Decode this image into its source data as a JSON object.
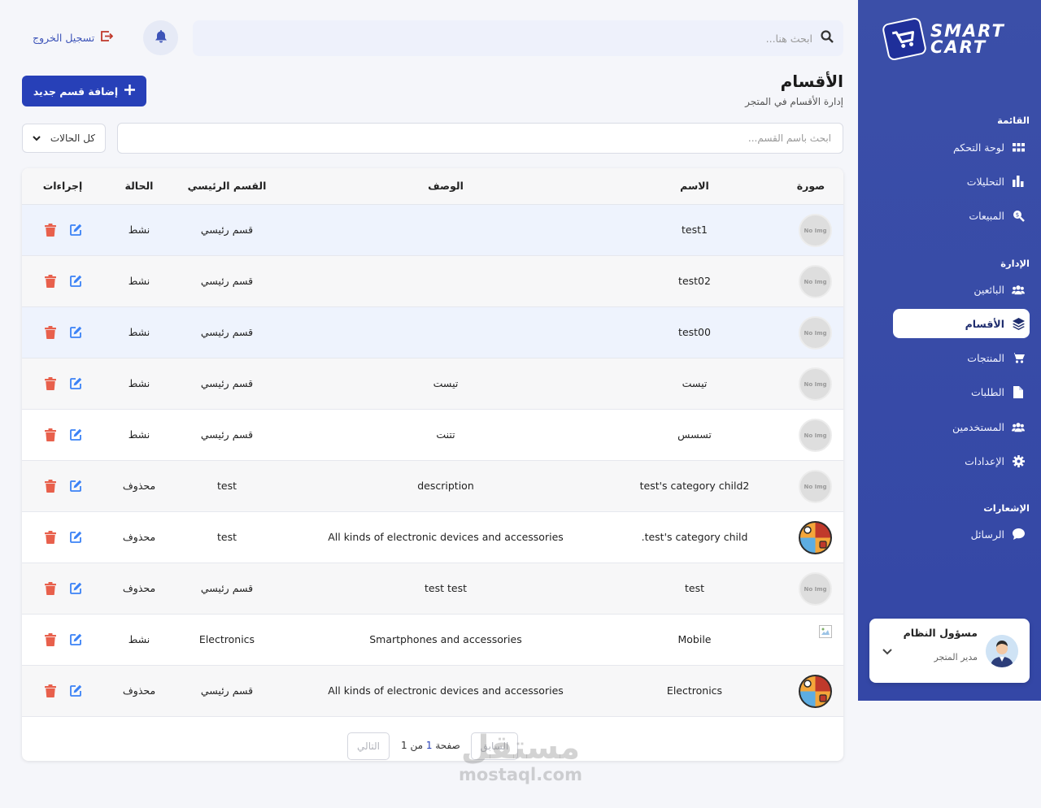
{
  "brand": {
    "line1": "SMART",
    "line2": "CART"
  },
  "sidebar": {
    "sections": [
      {
        "label": "القائمة"
      },
      {
        "label": "الإدارة"
      },
      {
        "label": "الإشعارات"
      }
    ],
    "items": [
      {
        "label": "لوحة التحكم",
        "icon": "grid-icon"
      },
      {
        "label": "التحليلات",
        "icon": "bar-chart-icon"
      },
      {
        "label": "المبيعات",
        "icon": "search-dollar-icon"
      },
      {
        "label": "البائعين",
        "icon": "users-icon"
      },
      {
        "label": "الأقسام",
        "icon": "layers-icon",
        "active": true
      },
      {
        "label": "المنتجات",
        "icon": "cart-icon"
      },
      {
        "label": "الطلبات",
        "icon": "file-icon"
      },
      {
        "label": "المستخدمين",
        "icon": "users-icon"
      },
      {
        "label": "الإعدادات",
        "icon": "gear-icon"
      },
      {
        "label": "الرسائل",
        "icon": "chat-icon"
      }
    ],
    "user": {
      "name": "مسؤول النظام",
      "role": "مدير المتجر"
    }
  },
  "topbar": {
    "search_placeholder": "ابحث هنا...",
    "logout_label": "تسجيل الخروج"
  },
  "page": {
    "title": "الأقسام",
    "subtitle": "إدارة الأقسام في المتجر",
    "add_button": "إضافة قسم جديد"
  },
  "filters": {
    "search_placeholder": "ابحث باسم القسم...",
    "status_selected": "كل الحالات"
  },
  "table": {
    "headers": {
      "image": "صورة",
      "name": "الاسم",
      "description": "الوصف",
      "parent": "القسم الرئيسي",
      "status": "الحالة",
      "actions": "إجراءات"
    },
    "rows": [
      {
        "image": "none",
        "name": "test1",
        "description": "",
        "parent": "قسم رئيسي",
        "status": "نشط"
      },
      {
        "image": "none",
        "name": "test02",
        "description": "",
        "parent": "قسم رئيسي",
        "status": "نشط"
      },
      {
        "image": "none",
        "name": "test00",
        "description": "",
        "parent": "قسم رئيسي",
        "status": "نشط"
      },
      {
        "image": "none",
        "name": "تيست",
        "description": "تيست",
        "parent": "قسم رئيسي",
        "status": "نشط"
      },
      {
        "image": "none",
        "name": "تسسس",
        "description": "تتنت",
        "parent": "قسم رئيسي",
        "status": "نشط"
      },
      {
        "image": "none",
        "name": "test's category child2",
        "description": "description",
        "parent": "test",
        "status": "محذوف"
      },
      {
        "image": "icon",
        "name": "test's category child.",
        "description": "All kinds of electronic devices and accessories",
        "parent": "test",
        "status": "محذوف"
      },
      {
        "image": "none",
        "name": "test",
        "description": "test test",
        "parent": "قسم رئيسي",
        "status": "محذوف"
      },
      {
        "image": "broken",
        "name": "Mobile",
        "description": "Smartphones and accessories",
        "parent": "Electronics",
        "status": "نشط"
      },
      {
        "image": "icon",
        "name": "Electronics",
        "description": "All kinds of electronic devices and accessories",
        "parent": "قسم رئيسي",
        "status": "محذوف"
      }
    ],
    "no_img_label": "No Img"
  },
  "pagination": {
    "prev": "السابق",
    "next": "التالي",
    "label_page": "صفحة",
    "current": "1",
    "label_of": "من",
    "total": "1"
  },
  "watermark": {
    "ar": "مستقل",
    "en": "mostaql.com"
  },
  "colors": {
    "sidebar": "#3b4fa8",
    "primary": "#2740b8",
    "delete": "#e8604c",
    "edit": "#3b82f6"
  }
}
